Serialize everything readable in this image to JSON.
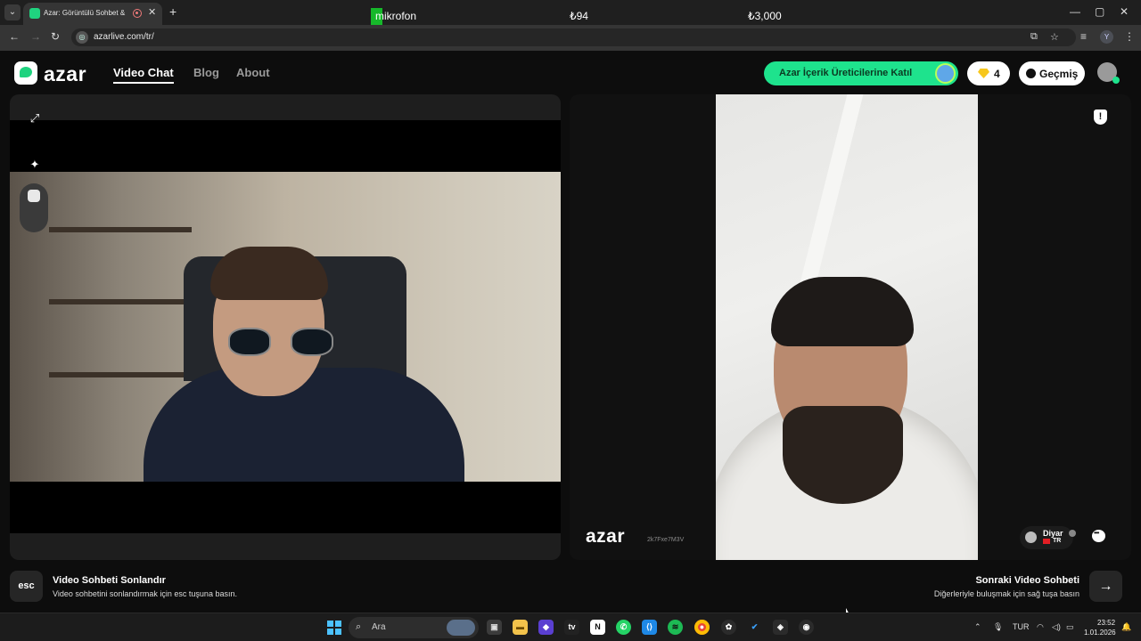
{
  "browser": {
    "tab_title": "Azar: Görüntülü Sohbet & V",
    "tab_close_glyph": "✕",
    "new_tab_glyph": "+",
    "url": "azarlive.com/tr/",
    "window_buttons": [
      "—",
      "▢",
      "✕"
    ],
    "nav_glyphs": {
      "back": "←",
      "forward": "→",
      "reload": "↻"
    },
    "profile_initial": "Y"
  },
  "overlay": {
    "mic_label": "mikrofon",
    "value_a": "₺94",
    "value_b": "₺3,000"
  },
  "header": {
    "logo_text": "azar",
    "nav": [
      {
        "label": "Video Chat",
        "active": true
      },
      {
        "label": "Blog",
        "active": false
      },
      {
        "label": "About",
        "active": false
      }
    ],
    "creator_cta": "Azar İçerik Üreticilerine Katıl",
    "gems": "4",
    "history": "Geçmiş"
  },
  "self_panel": {
    "tools": [
      "expand-icon",
      "sparkles-icon",
      "face-filter-icon"
    ],
    "tool_glyphs": {
      "expand": "⤢",
      "sparkles": "✦"
    }
  },
  "peer_panel": {
    "logo_text": "azar",
    "session_id": "2k7Fxe7M3V",
    "user_name": "Diyar",
    "country": "TR",
    "report_glyph": "!"
  },
  "actions": {
    "esc_key": "esc",
    "end_title": "Video Sohbeti Sonlandır",
    "end_desc": "Video sohbetini sonlandırmak için esc tuşuna basın.",
    "next_title": "Sonraki Video Sohbeti",
    "next_desc": "Diğerleriyle buluşmak için sağ tuşa basın",
    "next_glyph": "→"
  },
  "taskbar": {
    "search_placeholder": "Ara",
    "language": "TUR",
    "time": "23:52",
    "date": "1.01.2026",
    "whatsapp_badge": "4"
  },
  "colors": {
    "accent_green": "#1ee38d",
    "background": "#0d0d0d",
    "gem_yellow": "#f7c71c"
  }
}
